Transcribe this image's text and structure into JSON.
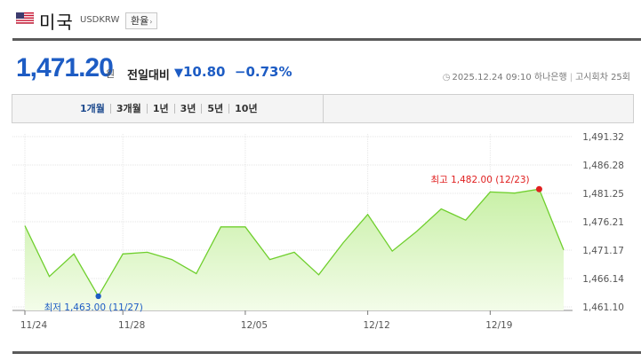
{
  "header": {
    "country": "미국",
    "code": "USDKRW",
    "fx_button": "환율",
    "flag_icon": "us-flag-icon"
  },
  "quote": {
    "price": "1,471.20",
    "unit": "원",
    "compare_label": "전일대비",
    "change_arrow": "▼",
    "change_value": "10.80",
    "change_percent": "−0.73%",
    "timestamp": "2025.12.24 09:10",
    "bank": "하나은행",
    "notice": "고시회차 25회",
    "color_down": "#1d5cc4"
  },
  "tabs": [
    {
      "label": "1개월",
      "active": true
    },
    {
      "label": "3개월",
      "active": false
    },
    {
      "label": "1년",
      "active": false
    },
    {
      "label": "3년",
      "active": false
    },
    {
      "label": "5년",
      "active": false
    },
    {
      "label": "10년",
      "active": false
    }
  ],
  "chart_data": {
    "type": "area",
    "x": [
      "11/24",
      "11/25",
      "11/26",
      "11/27",
      "11/28",
      "12/01",
      "12/02",
      "12/03",
      "12/04",
      "12/05",
      "12/08",
      "12/09",
      "12/10",
      "12/11",
      "12/12",
      "12/15",
      "12/16",
      "12/17",
      "12/18",
      "12/19",
      "12/22",
      "12/23",
      "12/24"
    ],
    "values": [
      1475.5,
      1466.5,
      1470.5,
      1463.0,
      1470.5,
      1470.8,
      1469.5,
      1467.0,
      1475.3,
      1475.3,
      1469.5,
      1470.8,
      1466.8,
      1472.5,
      1477.5,
      1471.0,
      1474.5,
      1478.5,
      1476.5,
      1481.5,
      1481.3,
      1482.0,
      1471.2
    ],
    "x_tick_labels": [
      "11/24",
      "11/28",
      "12/05",
      "12/12",
      "12/19"
    ],
    "y_tick_labels": [
      "1,491.32",
      "1,486.28",
      "1,481.25",
      "1,476.21",
      "1,471.17",
      "1,466.14",
      "1,461.10"
    ],
    "ylim": [
      1461.1,
      1491.32
    ],
    "grid": true,
    "line_color": "#6fcf2d",
    "fill_color": "#c8f0a6",
    "max_label": "최고 1,482.00 (12/23)",
    "min_label": "최저 1,463.00 (11/27)",
    "max_color": "#e02020",
    "min_color": "#1d5cc4"
  }
}
